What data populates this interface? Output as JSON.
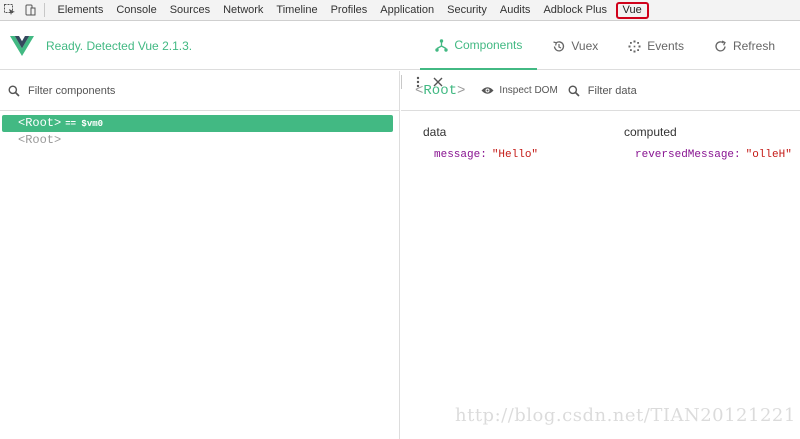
{
  "devtools": {
    "tabs": [
      "Elements",
      "Console",
      "Sources",
      "Network",
      "Timeline",
      "Profiles",
      "Application",
      "Security",
      "Audits",
      "Adblock Plus",
      "Vue"
    ],
    "active_tab": "Vue",
    "highlight_color": "#d0021b"
  },
  "vue": {
    "status": "Ready. Detected Vue 2.1.3.",
    "nav": {
      "components": "Components",
      "vuex": "Vuex",
      "events": "Events",
      "refresh": "Refresh"
    },
    "accent": "#42b983"
  },
  "left": {
    "filter_placeholder": "Filter components",
    "tree": [
      {
        "open": "<",
        "name": "Root",
        "close": ">",
        "vm": "== $vm0",
        "selected": true
      },
      {
        "open": "<",
        "name": "Root",
        "close": ">",
        "vm": "",
        "selected": false
      }
    ]
  },
  "right": {
    "selected_open": "<",
    "selected_name": "Root",
    "selected_close": ">",
    "inspect_label": "Inspect DOM",
    "filter_label": "Filter data",
    "data_heading": "data",
    "data_key": "message:",
    "data_value": "\"Hello\"",
    "computed_heading": "computed",
    "computed_key": "reversedMessage:",
    "computed_value": "\"olleH\""
  },
  "watermark": "http://blog.csdn.net/TIAN20121221"
}
